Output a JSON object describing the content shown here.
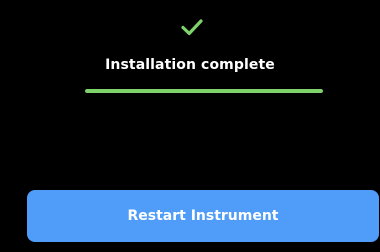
{
  "status": {
    "icon": "check-icon",
    "title": "Installation complete",
    "progress_percent": 100,
    "colors": {
      "check": "#7ed36b",
      "progress": "#7ed36b"
    }
  },
  "actions": {
    "restart_label": "Restart Instrument",
    "restart_color": "#4f9cf9"
  }
}
